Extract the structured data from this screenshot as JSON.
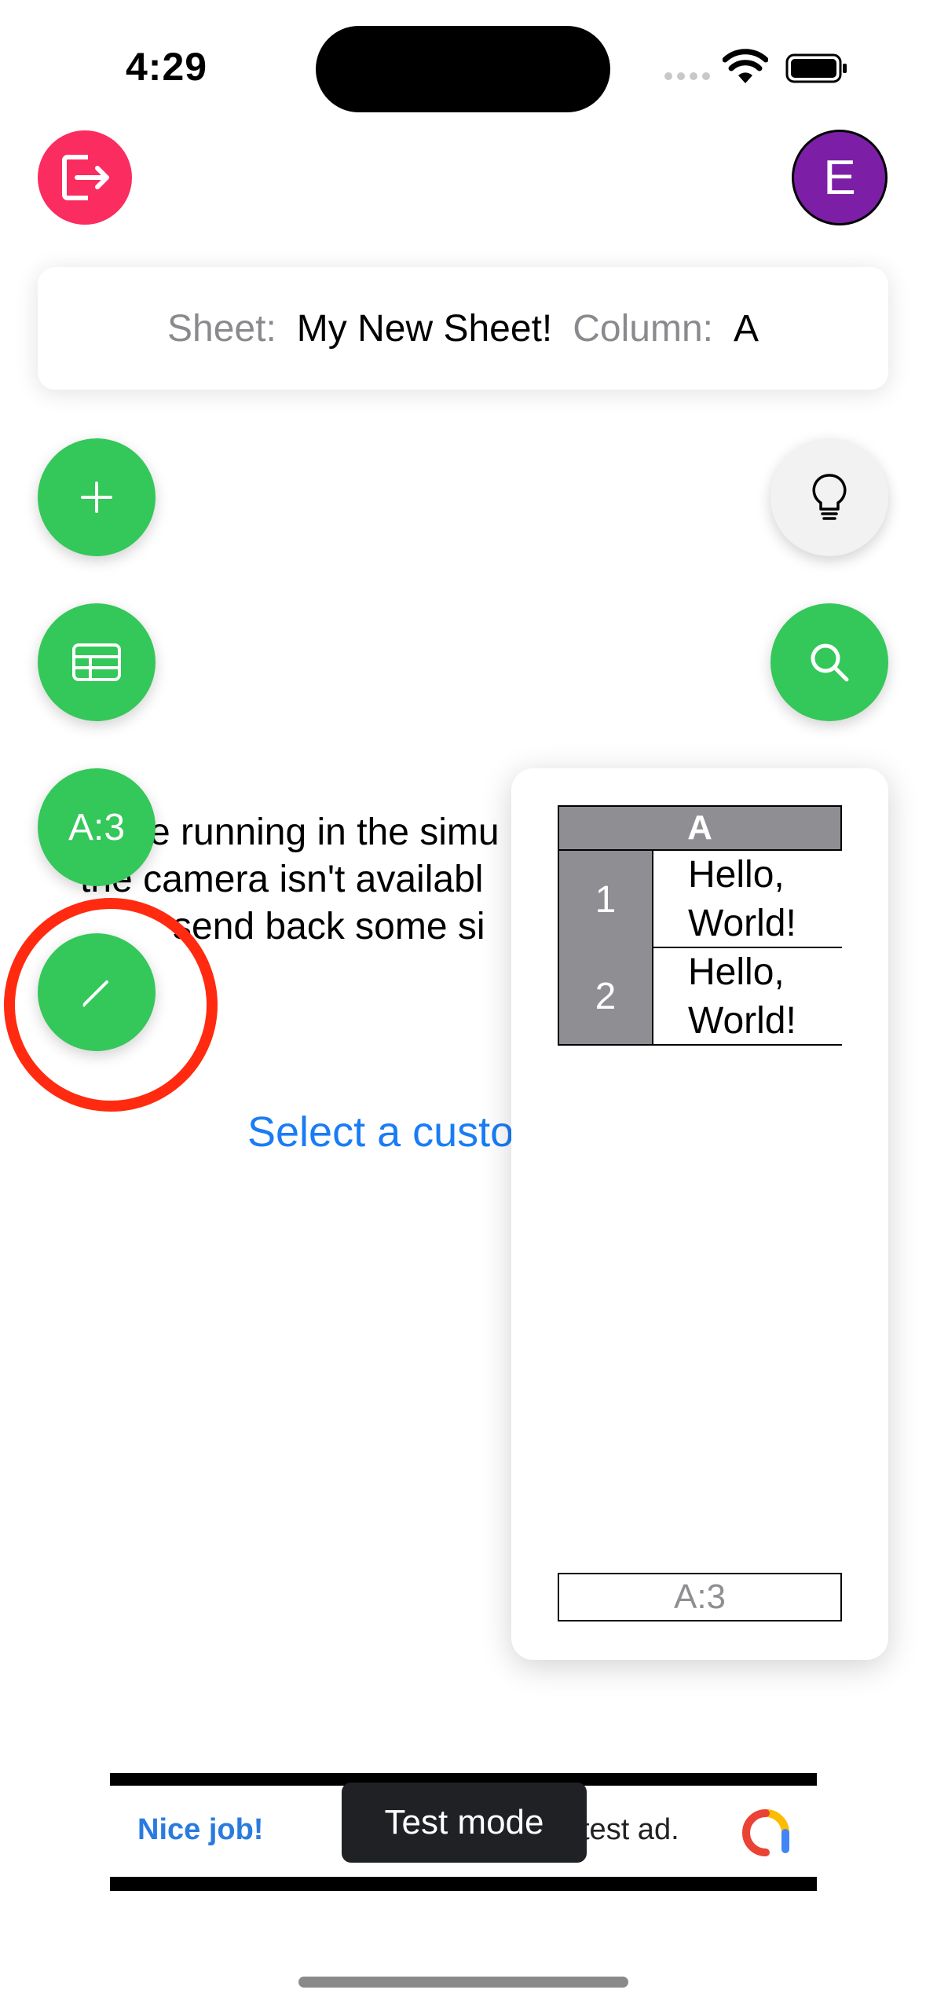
{
  "status_bar": {
    "time": "4:29"
  },
  "header": {
    "avatar_letter": "E"
  },
  "info": {
    "sheet_label": "Sheet:",
    "sheet_name": "My New Sheet!",
    "column_label": "Column:",
    "column_value": "A"
  },
  "fabs": {
    "cell_ref": "A:3"
  },
  "background": {
    "line1": "e running in the simu",
    "line2": "the camera isn't availabl",
    "line3": "send back some si",
    "link": "Select a custo"
  },
  "sheet_panel": {
    "column_header": "A",
    "rows": [
      {
        "index": "1",
        "line1": "Hello,",
        "line2": "World!"
      },
      {
        "index": "2",
        "line1": "Hello,",
        "line2": "World!"
      }
    ],
    "cell_input_placeholder": "A:3"
  },
  "ad": {
    "left_text": "Nice job!",
    "right_text": "test ad.",
    "toast": "Test mode"
  },
  "colors": {
    "green": "#34c759",
    "logout": "#fb2c5f",
    "avatar": "#7d1fa6",
    "highlight": "#ff2a0f",
    "link": "#1a7cf5",
    "grid_header": "#8e8e93"
  }
}
